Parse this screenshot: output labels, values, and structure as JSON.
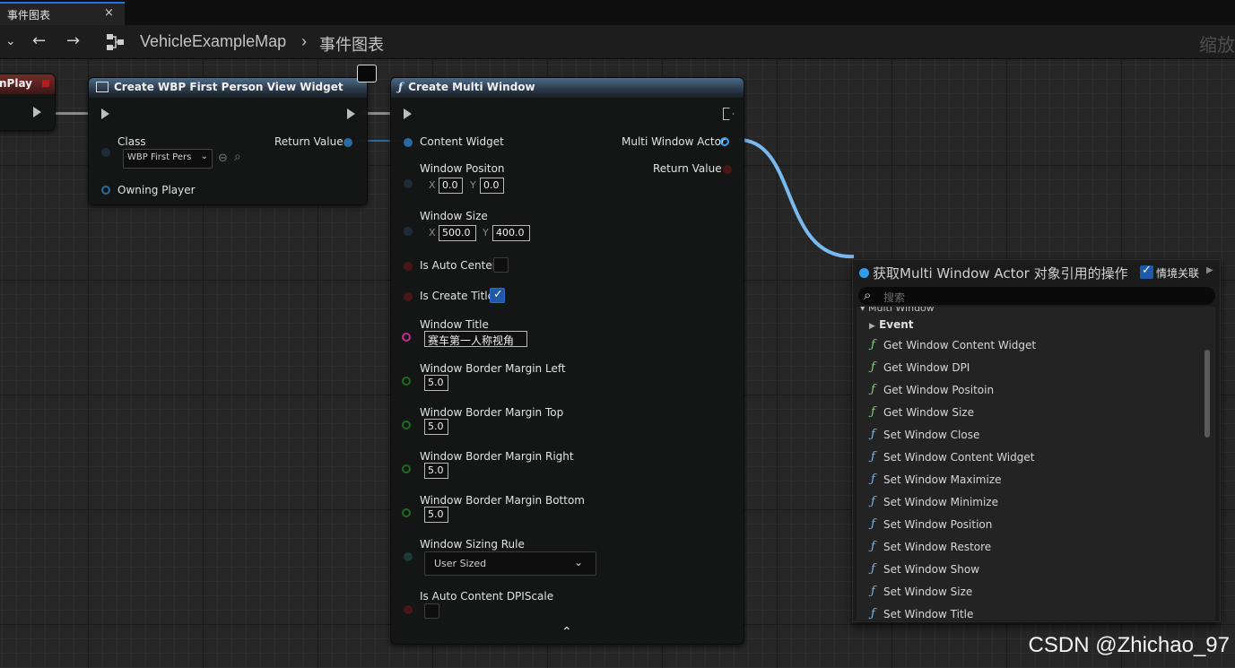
{
  "tab": {
    "title": "事件图表",
    "close": "×"
  },
  "toolbar": {
    "menu": "⌄",
    "back": "←",
    "forward": "→",
    "breadcrumb_map": "VehicleExampleMap",
    "breadcrumb_sep": "›",
    "breadcrumb_graph": "事件图表",
    "zoom_label": "缩放"
  },
  "begin_play": {
    "title": "nPlay"
  },
  "create_widget": {
    "title": "Create WBP First Person View Widget",
    "class_label": "Class",
    "class_value": "WBP First Pers",
    "return_label": "Return Value",
    "owning_player": "Owning Player"
  },
  "multi_window": {
    "title": "Create Multi Window",
    "content_widget": "Content Widget",
    "actor_out": "Multi Window Actor",
    "return_value": "Return Value",
    "position_label": "Window Positon",
    "pos_x": "0.0",
    "pos_y": "0.0",
    "size_label": "Window Size",
    "size_x": "500.0",
    "size_y": "400.0",
    "axis_x": "X",
    "axis_y": "Y",
    "auto_center": "Is Auto Center",
    "auto_center_checked": false,
    "create_title": "Is Create Title",
    "create_title_checked": true,
    "window_title_label": "Window Title",
    "window_title_value": "赛车第一人称视角",
    "margin_left_label": "Window Border Margin Left",
    "margin_left": "5.0",
    "margin_top_label": "Window Border Margin Top",
    "margin_top": "5.0",
    "margin_right_label": "Window Border Margin Right",
    "margin_right": "5.0",
    "margin_bottom_label": "Window Border Margin Bottom",
    "margin_bottom": "5.0",
    "sizing_rule_label": "Window Sizing Rule",
    "sizing_rule_value": "User Sized",
    "dpi_label": "Is Auto Content DPIScale",
    "collapse": "⌃"
  },
  "context_menu": {
    "title": "获取Multi Window Actor 对象引用的操作",
    "context_toggle": "情境关联",
    "search_placeholder": "搜索",
    "category": "Multi Window",
    "subcategory": "Event",
    "items": [
      {
        "label": "Get Window Content Widget",
        "kind": "get"
      },
      {
        "label": "Get Window DPI",
        "kind": "get"
      },
      {
        "label": "Get Window Positoin",
        "kind": "get"
      },
      {
        "label": "Get Window Size",
        "kind": "get"
      },
      {
        "label": "Set Window Close",
        "kind": "set"
      },
      {
        "label": "Set Window Content Widget",
        "kind": "set"
      },
      {
        "label": "Set Window Maximize",
        "kind": "set"
      },
      {
        "label": "Set Window Minimize",
        "kind": "set"
      },
      {
        "label": "Set Window Position",
        "kind": "set"
      },
      {
        "label": "Set Window Restore",
        "kind": "set"
      },
      {
        "label": "Set Window Show",
        "kind": "set"
      },
      {
        "label": "Set Window Size",
        "kind": "set"
      },
      {
        "label": "Set Window Title",
        "kind": "set"
      }
    ]
  },
  "colors": {
    "get_icon": "#7fd67f",
    "set_icon": "#7ab8f0",
    "accent": "#2f9cf0"
  },
  "watermark": "CSDN @Zhichao_97"
}
